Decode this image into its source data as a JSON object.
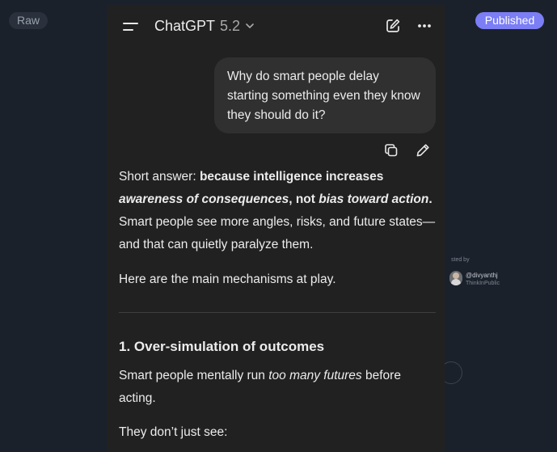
{
  "badges": {
    "raw": "Raw",
    "published": "Published"
  },
  "meta": {
    "posted_by": "sted by",
    "author_handle": "@divyanthj",
    "author_sub": "ThinkInPublic"
  },
  "header": {
    "model_name": "ChatGPT",
    "model_version": "5.2"
  },
  "conversation": {
    "user_message": "Why do smart people delay starting something even they know they should do it?",
    "answer": {
      "short_prefix": "Short answer: ",
      "bold_part1": "because intelligence increases ",
      "bold_italic1": "awareness of consequences",
      "bold_part2": ", not ",
      "bold_italic2": "bias toward action",
      "bold_end": ".",
      "line2": "Smart people see more angles, risks, and future states—and that can quietly paralyze them.",
      "mechanisms": "Here are the main mechanisms at play.",
      "section1_title": "1. Over-simulation of outcomes",
      "section1_pre": "Smart people mentally run ",
      "section1_italic": "too many futures",
      "section1_post": " before acting.",
      "section1_more": "They don’t just see:"
    }
  },
  "colors": {
    "background": "#1b212b",
    "panel": "#212121",
    "bubble": "#303030",
    "accent": "#7b7ef5"
  },
  "icons": [
    "menu-icon",
    "chevron-down-icon",
    "new-chat-icon",
    "more-icon",
    "copy-icon",
    "edit-icon"
  ]
}
